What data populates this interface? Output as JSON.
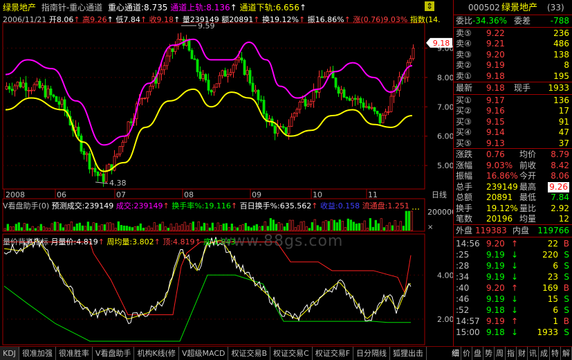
{
  "header": {
    "stock": "绿景地产",
    "indicator": "指南针-重心通道",
    "center": "重心通道:8.735",
    "upper": "通道上轨:8.136",
    "lower": "通道下轨:6.656",
    "scroll_glyph": "⇕"
  },
  "quote_line": {
    "date": "2006/11/21",
    "open": "开8.06",
    "high": "高9.26",
    "low": "低7.84",
    "close": "收9.18",
    "vol": "量239149",
    "amount": "额20891",
    "turnover": "换19.12%",
    "amp": "振16.86%",
    "change": "涨(0.76)9.03%",
    "index": "指数(14."
  },
  "price_chart": {
    "y_ticks": [
      "9.00",
      "8.00",
      "7.00",
      "6.00",
      "5.00"
    ],
    "current_price": "9.18",
    "peak_label": "9.59",
    "trough_label": "4.38",
    "x_labels": [
      "2008",
      "06",
      "07",
      "08",
      "09",
      "10",
      "11"
    ],
    "period": "日线"
  },
  "volume_panel": {
    "title": "V看盘助手(0)",
    "forecast": "预测成交:239149",
    "deal": "成交:239149",
    "turnover_rate": "换手率%:19.116",
    "hundred_day": "百日换手%:635.562",
    "gain": "收益:0.158",
    "float": "流通盘:1.251",
    "y_tick": "200000",
    "unit": "×"
  },
  "indicator_panel": {
    "title": "量价背离指标",
    "monthly": "月量价:4.819",
    "weekly": "周均量:3.802",
    "top": "顶:4.819",
    "bottom": "底:1.843",
    "y_ticks": [
      "4.00",
      "2.00"
    ],
    "watermark": "www.88gs.com"
  },
  "quote_panel": {
    "code": "000502",
    "name": "绿景地产",
    "badge": "(33)",
    "weibi_label": "委比",
    "weibi_value": "-34.36%",
    "weicha_label": "委差",
    "weicha_value": "-788",
    "asks": [
      {
        "label": "卖⑤",
        "price": "9.22",
        "vol": "236"
      },
      {
        "label": "卖④",
        "price": "9.21",
        "vol": "486"
      },
      {
        "label": "卖③",
        "price": "9.20",
        "vol": "138"
      },
      {
        "label": "卖②",
        "price": "9.19",
        "vol": "8"
      },
      {
        "label": "卖①",
        "price": "9.18",
        "vol": "195"
      }
    ],
    "latest_label": "最新",
    "latest": "9.18",
    "now_hand_label": "现手",
    "now_hand": "1933",
    "bids": [
      {
        "label": "买①",
        "price": "9.17",
        "vol": "136"
      },
      {
        "label": "买②",
        "price": "9.16",
        "vol": "17"
      },
      {
        "label": "买③",
        "price": "9.15",
        "vol": "91"
      },
      {
        "label": "买④",
        "price": "9.14",
        "vol": "47"
      },
      {
        "label": "买⑤",
        "price": "9.13",
        "vol": "37"
      }
    ],
    "stats": [
      {
        "l1": "涨跌",
        "v1": "0.76",
        "l2": "均价",
        "v2": "8.79"
      },
      {
        "l1": "涨幅",
        "v1": "9.03%",
        "l2": "前收",
        "v2": "8.42"
      },
      {
        "l1": "振幅",
        "v1": "16.86%",
        "l2": "今开",
        "v2": "8.06"
      },
      {
        "l1": "总手",
        "v1": "239149",
        "l2": "最高",
        "v2": "9.26"
      },
      {
        "l1": "总额",
        "v1": "20891",
        "l2": "最低",
        "v2": "7.84"
      },
      {
        "l1": "换手",
        "v1": "19.12%",
        "l2": "量比",
        "v2": "2.92"
      },
      {
        "l1": "笔数",
        "v1": "20196",
        "l2": "均量",
        "v2": "12"
      }
    ],
    "outer_label": "外盘",
    "outer": "119383",
    "inner_label": "内盘",
    "inner": "119766",
    "ticks": [
      {
        "time": "14:56",
        "price": "9.20",
        "vol": "22",
        "side": "B"
      },
      {
        "time": ":25",
        "price": "9.19",
        "vol": "220",
        "side": "S"
      },
      {
        "time": ":28",
        "price": "9.19",
        "vol": "6",
        "side": "S"
      },
      {
        "time": ":34",
        "price": "9.19",
        "vol": "23",
        "side": "S"
      },
      {
        "time": ":40",
        "price": "9.20",
        "vol": "169",
        "side": "B"
      },
      {
        "time": ":46",
        "price": "9.19",
        "vol": "15",
        "side": "S"
      },
      {
        "time": ":52",
        "price": "9.18",
        "vol": "6",
        "side": "S"
      },
      {
        "time": "14:57",
        "price": "9.19",
        "vol": "1",
        "side": "B"
      },
      {
        "time": "15:00",
        "price": "9.18",
        "vol": "1933",
        "side": "S"
      }
    ]
  },
  "tabs": [
    "KDJ",
    "很准加强",
    "很准胜率",
    "V看盘助手",
    "机构K线(修",
    "V超级MACD",
    "权证交易B",
    "权证交易C",
    "权证交易F",
    "日分隔线",
    "狐狸出击"
  ],
  "right_tabs": [
    "细",
    "价",
    "盘",
    "势",
    "周",
    "指",
    "财",
    "讯",
    "成",
    "特",
    "解"
  ]
}
